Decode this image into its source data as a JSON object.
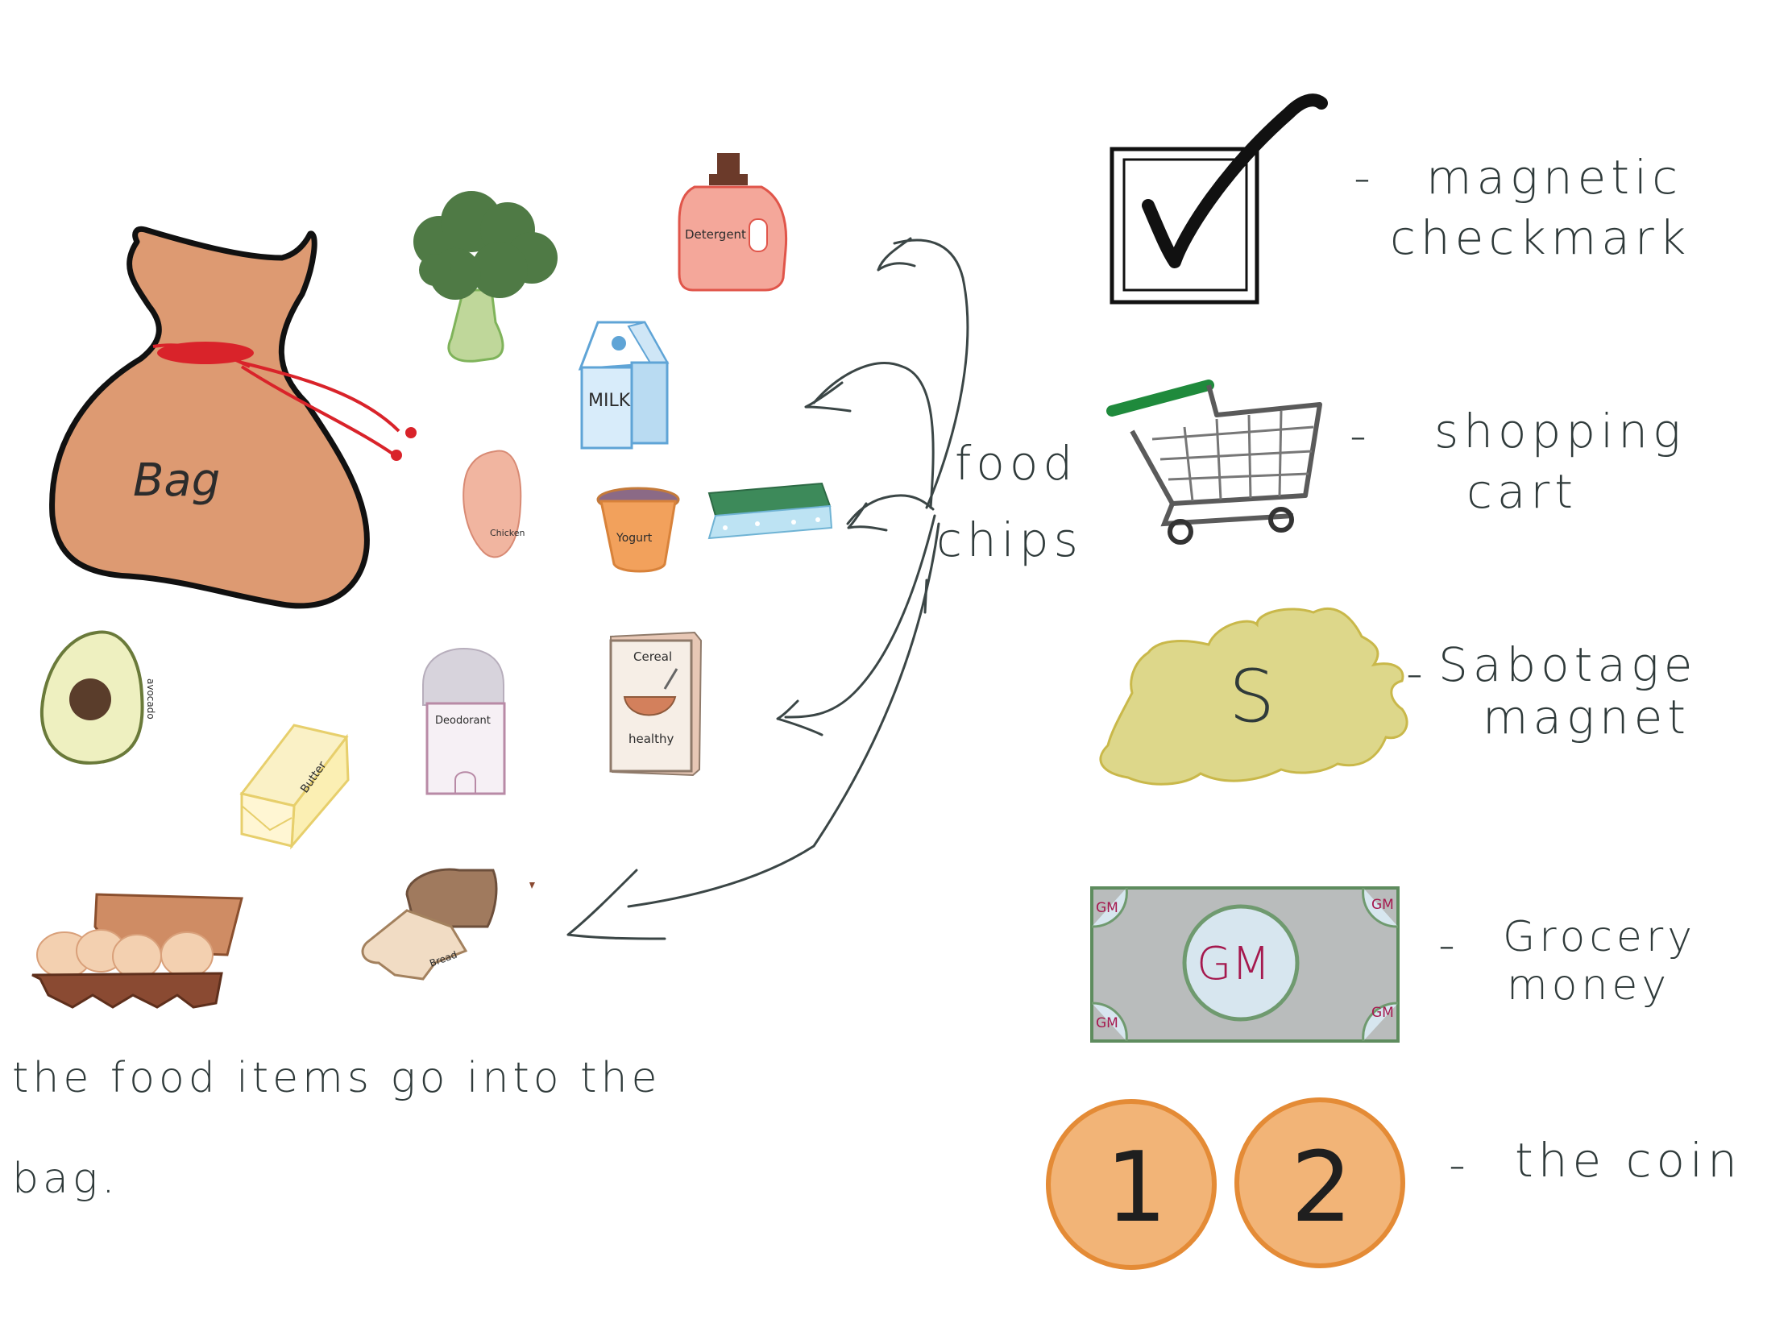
{
  "items": {
    "bag": "Bag",
    "detergent": "Detergent",
    "milk": "MILK",
    "chicken": "Chicken",
    "yogurt": "Yogurt",
    "avocado": "avocado",
    "deodorant": "Deodorant",
    "cereal_title": "Cereal",
    "cereal_sub": "healthy",
    "butter": "Butter",
    "bread": "Bread"
  },
  "annotations": {
    "food_line1": "food",
    "food_line2": "chips",
    "bag_note_line1": "the food items go into the",
    "bag_note_line2": "bag."
  },
  "legend": {
    "checkmark_line1": "magnetic",
    "checkmark_line2": "checkmark",
    "cart_line1": "shopping",
    "cart_line2": "cart",
    "sabotage_letter": "S",
    "sabotage_line1": "Sabotage",
    "sabotage_line2": "magnet",
    "money_center": "GM",
    "money_corner": "GM",
    "money_line1": "Grocery",
    "money_line2": "money",
    "coin1": "1",
    "coin2": "2",
    "coin_label": "the coin",
    "dash": "-"
  },
  "colors": {
    "bag_fill": "#dd9a72",
    "bag_tie": "#d9232a",
    "cart_handle": "#1f8a3c",
    "sabotage_fill": "#ddd78a",
    "money_fill": "#b9bcbc",
    "money_text": "#a5194e",
    "coin_fill": "#f2b477",
    "ink": "#2f3a3a"
  }
}
